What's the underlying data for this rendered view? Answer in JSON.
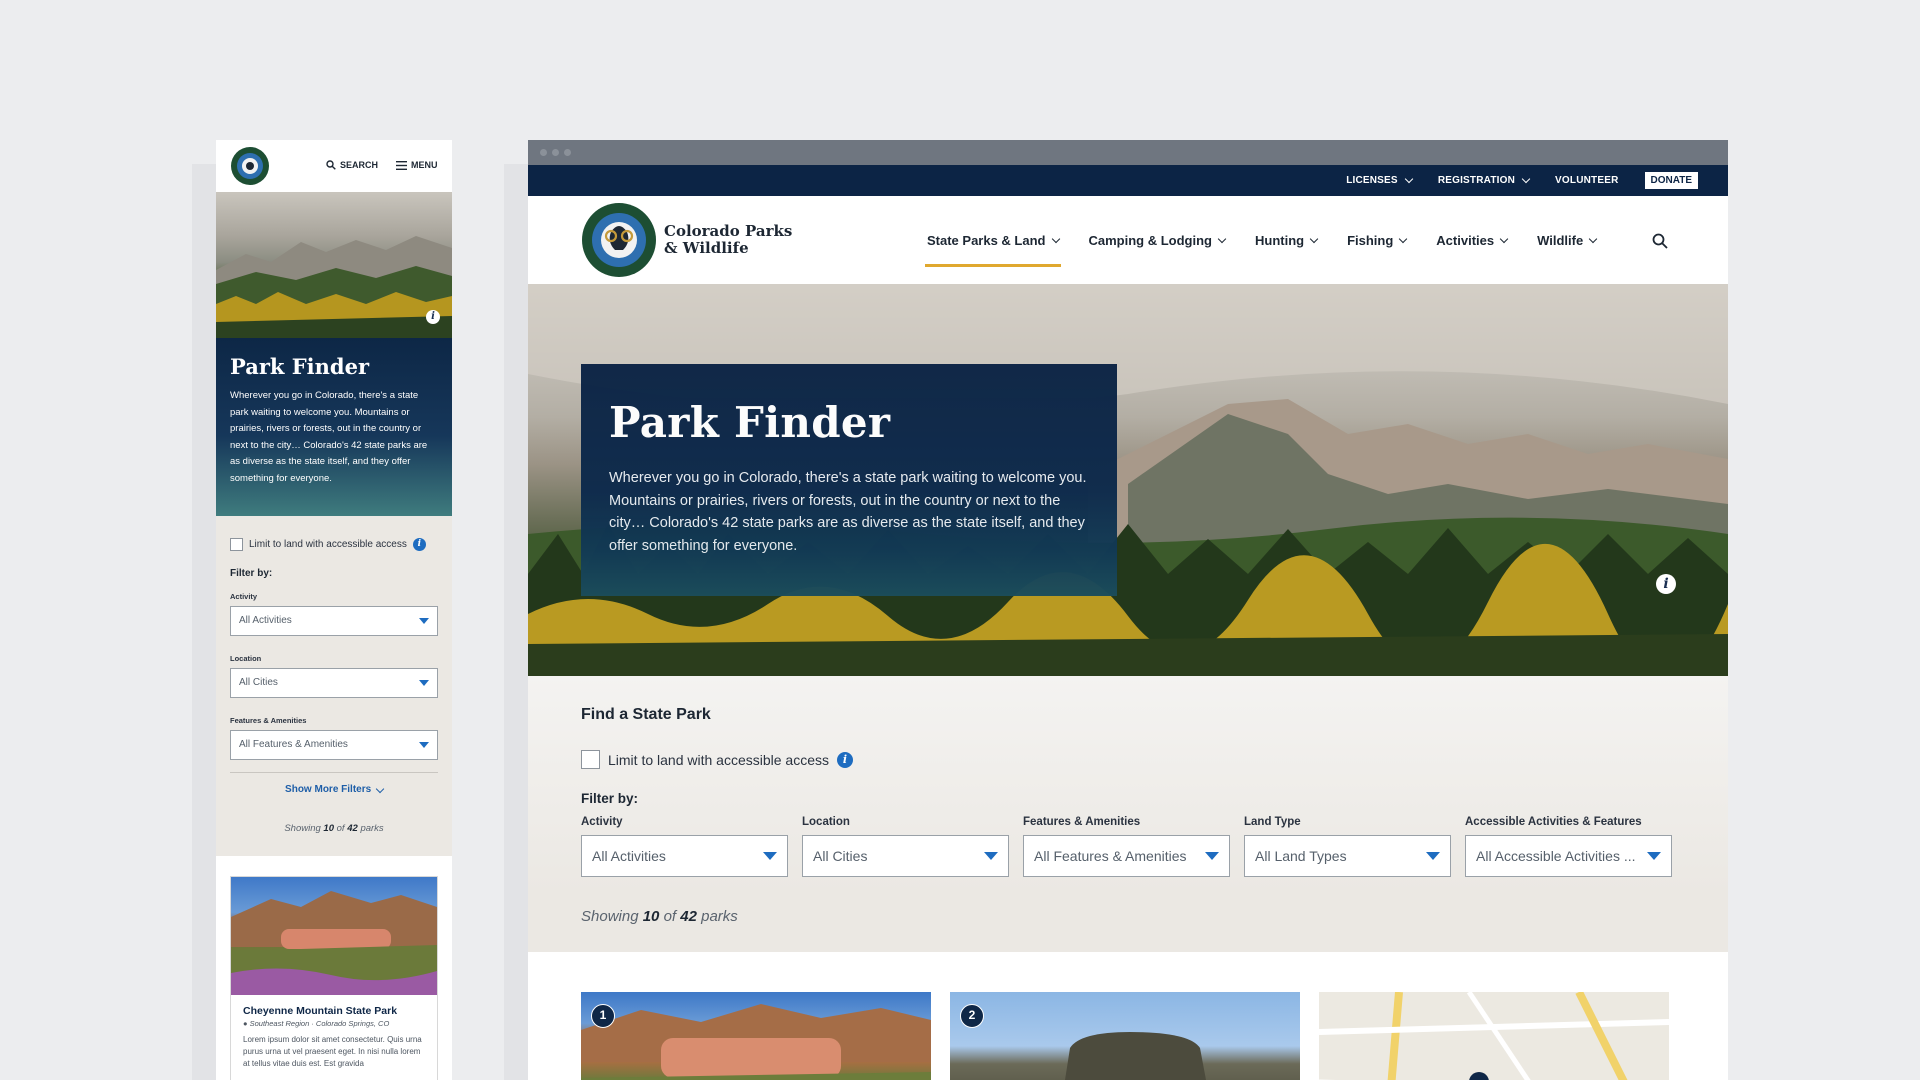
{
  "mobile": {
    "search_label": "SEARCH",
    "menu_label": "MENU",
    "title": "Park Finder",
    "intro": "Wherever you go in Colorado, there's a state park waiting to welcome you. Mountains or prairies, rivers or forests, out in the country or next to the city… Colorado's 42 state parks are as diverse as the state itself, and they offer something for everyone.",
    "accessible_label": "Limit to land with accessible access",
    "filter_by": "Filter by:",
    "filters": [
      {
        "label": "Activity",
        "value": "All Activities"
      },
      {
        "label": "Location",
        "value": "All Cities"
      },
      {
        "label": "Features & Amenities",
        "value": "All Features & Amenities"
      }
    ],
    "show_more": "Show More Filters",
    "showing_prefix": "Showing",
    "showing_count": "10",
    "showing_of": "of",
    "showing_total": "42",
    "showing_suffix": "parks",
    "card": {
      "title": "Cheyenne Mountain State Park",
      "location": "Southeast Region · Colorado Springs, CO",
      "description": "Lorem ipsum dolor sit amet consectetur. Quis urna purus urna ut vel praesent eget. In nisi nulla lorem at tellus vitae duis est. Est gravida"
    }
  },
  "desktop": {
    "utility_nav": [
      "LICENSES",
      "REGISTRATION",
      "VOLUNTEER"
    ],
    "donate_label": "DONATE",
    "brand_line1": "Colorado Parks",
    "brand_line2": "& Wildlife",
    "main_nav": [
      "State Parks & Land",
      "Camping & Lodging",
      "Hunting",
      "Fishing",
      "Activities",
      "Wildlife"
    ],
    "active_nav": "State Parks & Land",
    "hero_title": "Park Finder",
    "hero_text": "Wherever you go in Colorado, there's a state park waiting to welcome you. Mountains or prairies, rivers or forests, out in the country or next to the city… Colorado's 42 state parks are as diverse as the state itself, and they offer something for everyone.",
    "finder_title": "Find a State Park",
    "accessible_label": "Limit to land with accessible access",
    "filter_by": "Filter by:",
    "filters": [
      {
        "label": "Activity",
        "value": "All Activities"
      },
      {
        "label": "Location",
        "value": "All Cities"
      },
      {
        "label": "Features & Amenities",
        "value": "All Features & Amenities"
      },
      {
        "label": "Land Type",
        "value": "All Land Types"
      },
      {
        "label": "Accessible Activities & Features",
        "value": "All Accessible Activities ..."
      }
    ],
    "showing_prefix": "Showing",
    "showing_count": "10",
    "showing_of": "of",
    "showing_total": "42",
    "showing_suffix": "parks",
    "result_numbers": [
      "1",
      "2"
    ]
  },
  "colors": {
    "navy": "#0c2445",
    "accent_gold": "#e0a82e",
    "link_blue": "#1e6cc0",
    "background": "#ecedef"
  },
  "icons": [
    "search-icon",
    "menu-icon",
    "info-icon",
    "chevron-down-icon",
    "location-pin-icon",
    "logo-emblem"
  ]
}
